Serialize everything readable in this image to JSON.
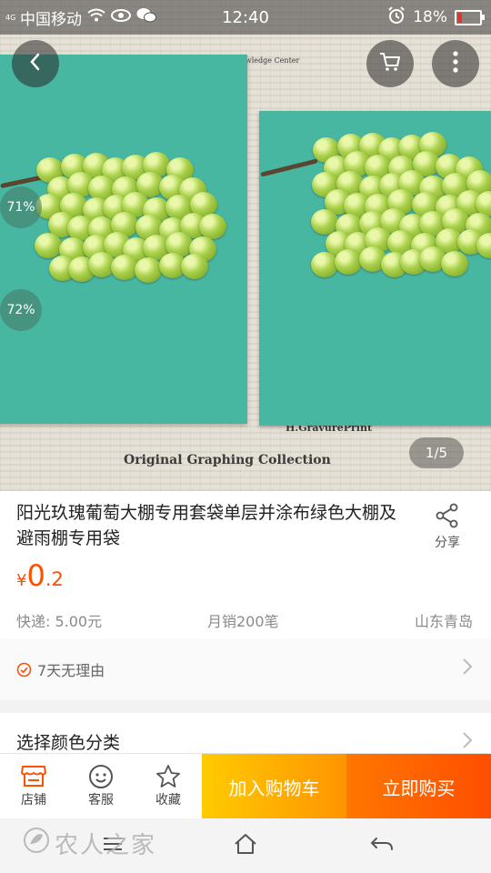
{
  "status_bar": {
    "network_type": "4G",
    "carrier": "中国移动",
    "time": "12:40",
    "battery": "18%",
    "battery_level": 0.18
  },
  "gallery": {
    "page_indicator": "1/5",
    "overlay_badges": [
      "71%",
      "72%"
    ],
    "background_text": [
      "International Business Knowledge Center",
      "H.GravurePrint",
      "Original Graphing Collection"
    ]
  },
  "product": {
    "title": "阳光玖瑰葡萄大棚专用套袋单层并涂布绿色大棚及避雨棚专用袋",
    "share_label": "分享",
    "price_symbol": "¥",
    "price_integer": "0",
    "price_decimal": ".2",
    "shipping": "快递: 5.00元",
    "monthly_sales": "月销200笔",
    "location": "山东青岛"
  },
  "guarantee": {
    "label": "7天无理由"
  },
  "options": {
    "select_label": "选择颜色分类"
  },
  "action_bar": {
    "shop_label": "店铺",
    "service_label": "客服",
    "favorite_label": "收藏",
    "add_to_cart_label": "加入购物车",
    "buy_now_label": "立即购买"
  },
  "watermark": {
    "text": "农人之家"
  },
  "colors": {
    "accent_orange": "#ff5000",
    "cart_yellow": "#ffb400",
    "buy_orange": "#ff5a00",
    "bag_green": "#48b7a2"
  },
  "icons": {
    "back": "chevron-left-icon",
    "cart": "shopping-cart-icon",
    "more": "more-vertical-icon",
    "share": "share-icon",
    "check": "check-circle-icon",
    "shop": "store-icon",
    "service": "smiley-icon",
    "favorite": "star-icon"
  }
}
